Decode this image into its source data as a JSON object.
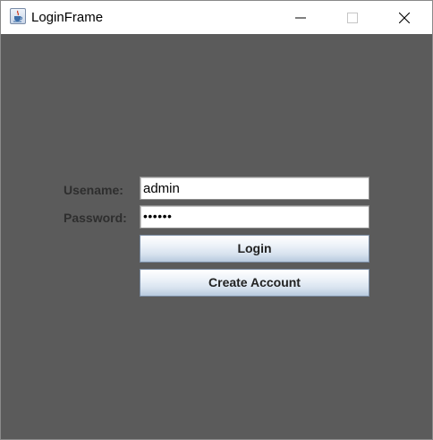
{
  "window": {
    "title": "LoginFrame",
    "icon": "java-cup-icon",
    "controls": [
      "minimize-icon",
      "maximize-icon",
      "close-icon"
    ]
  },
  "form": {
    "username_label": "Usename:",
    "username_value": "admin",
    "password_label": "Password:",
    "password_value": "••••••",
    "login_label": "Login",
    "create_account_label": "Create Account"
  },
  "colors": {
    "background": "#5b5b5b",
    "titlebar": "#ffffff",
    "label_text": "#2e2e2e",
    "button_gradient_top": "#ffffff",
    "button_gradient_bottom": "#b8cade"
  }
}
